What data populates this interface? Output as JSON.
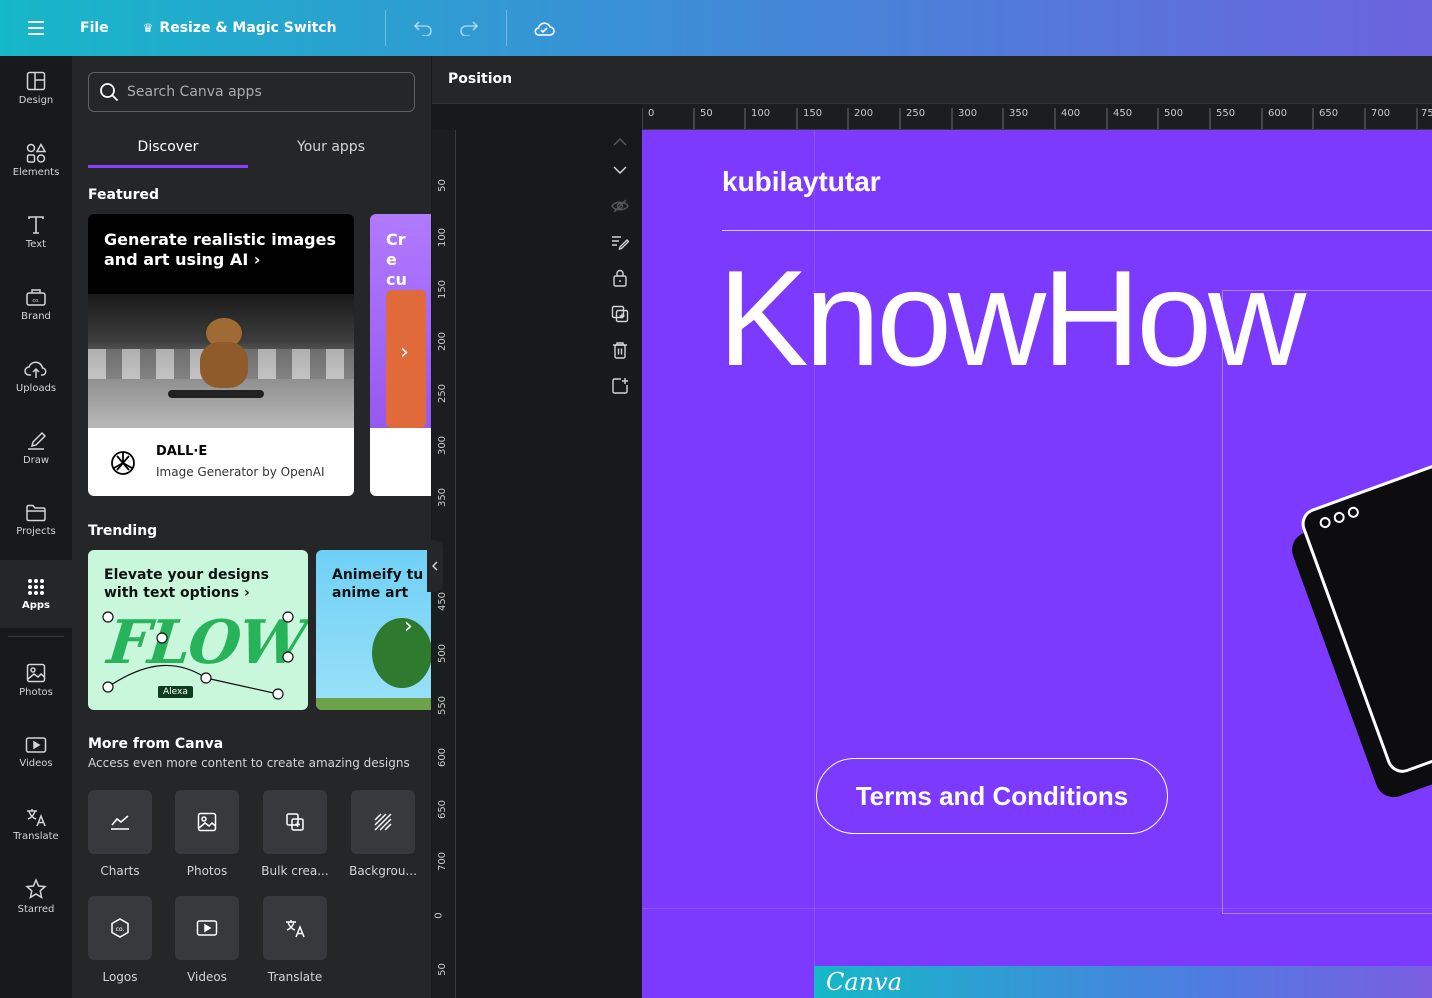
{
  "topbar": {
    "file_label": "File",
    "resize_label": "Resize & Magic Switch"
  },
  "rail": {
    "items": [
      {
        "label": "Design",
        "icon": "layout-icon"
      },
      {
        "label": "Elements",
        "icon": "shapes-icon"
      },
      {
        "label": "Text",
        "icon": "text-icon"
      },
      {
        "label": "Brand",
        "icon": "brand-icon"
      },
      {
        "label": "Uploads",
        "icon": "upload-cloud-icon"
      },
      {
        "label": "Draw",
        "icon": "pen-icon"
      },
      {
        "label": "Projects",
        "icon": "folder-icon"
      },
      {
        "label": "Apps",
        "icon": "grid-icon",
        "active": true
      },
      {
        "label": "Photos",
        "icon": "image-icon"
      },
      {
        "label": "Videos",
        "icon": "video-icon"
      },
      {
        "label": "Translate",
        "icon": "translate-icon"
      },
      {
        "label": "Starred",
        "icon": "star-icon"
      }
    ]
  },
  "panel": {
    "search_placeholder": "Search Canva apps",
    "tabs": [
      "Discover",
      "Your apps"
    ],
    "featured_heading": "Featured",
    "featured_card": {
      "title": "Generate realistic images and art using AI",
      "app_name": "DALL·E",
      "app_desc": "Image Generator by OpenAI"
    },
    "featured_card2_title": "Cre cus",
    "trending_heading": "Trending",
    "trending": [
      {
        "title": "Elevate your designs with text options",
        "art_text": "FLOW",
        "tag": "Alexa"
      },
      {
        "title": "Animeify tu anime art"
      }
    ],
    "more_heading": "More from Canva",
    "more_sub": "Access even more content to create amazing designs",
    "more_apps": [
      {
        "label": "Charts",
        "icon": "chart-line-icon"
      },
      {
        "label": "Photos",
        "icon": "image-icon"
      },
      {
        "label": "Bulk crea...",
        "icon": "bulk-create-icon"
      },
      {
        "label": "Backgrou...",
        "icon": "background-pattern-icon"
      },
      {
        "label": "Logos",
        "icon": "logo-badge-icon"
      },
      {
        "label": "Videos",
        "icon": "video-icon"
      },
      {
        "label": "Translate",
        "icon": "translate-icon"
      }
    ]
  },
  "editor": {
    "context_label": "Position",
    "h_ruler": [
      "0",
      "50",
      "100",
      "150",
      "200",
      "250",
      "300",
      "350",
      "400",
      "450",
      "500",
      "550",
      "600",
      "650",
      "700",
      "75"
    ],
    "v_ruler": [
      "50",
      "100",
      "150",
      "200",
      "250",
      "300",
      "350",
      "450",
      "500",
      "550",
      "600",
      "650",
      "700",
      "0",
      "50"
    ]
  },
  "design": {
    "author": "kubilaytutar",
    "headline": "KnowHow",
    "button_text": "Terms and Conditions",
    "footer_logo": "Canva",
    "colors": {
      "background": "#7c3aff",
      "text": "#ffffff"
    }
  }
}
